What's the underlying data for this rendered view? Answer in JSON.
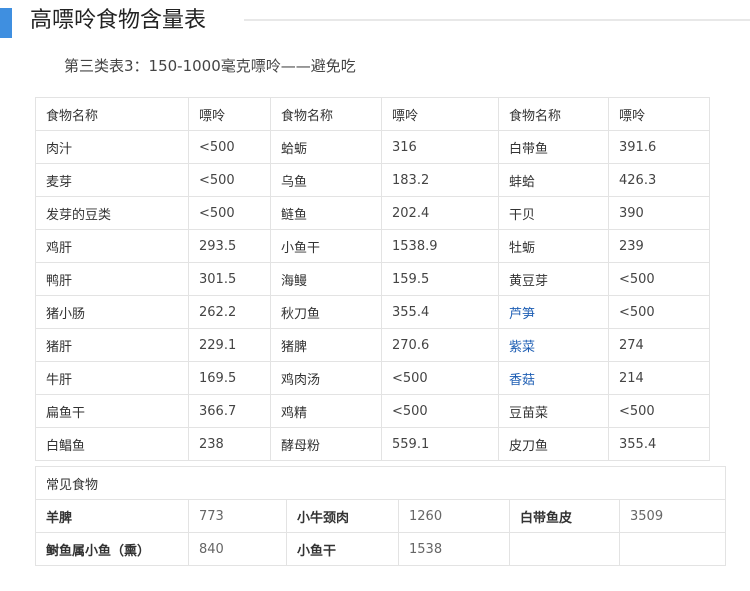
{
  "page_title": "高嘌呤食物含量表",
  "subtitle": "第三类表3：150-1000毫克嘌呤——避免吃",
  "accent_color": "#3f8fe0",
  "link_color": "#1f5fb4",
  "table": {
    "headers": [
      "食物名称",
      "嘌呤",
      "食物名称",
      "嘌呤",
      "食物名称",
      "嘌呤"
    ],
    "rows": [
      [
        "肉汁",
        "<500",
        "蛤蛎",
        "316",
        "白带鱼",
        "391.6"
      ],
      [
        "麦芽",
        "<500",
        "乌鱼",
        "183.2",
        "蚌蛤",
        "426.3"
      ],
      [
        "发芽的豆类",
        "<500",
        "鲢鱼",
        "202.4",
        "干贝",
        "390"
      ],
      [
        "鸡肝",
        "293.5",
        "小鱼干",
        "1538.9",
        "牡蛎",
        "239"
      ],
      [
        "鸭肝",
        "301.5",
        "海鳗",
        "159.5",
        "黄豆芽",
        "<500"
      ],
      [
        "猪小肠",
        "262.2",
        "秋刀鱼",
        "355.4",
        "芦笋",
        "<500"
      ],
      [
        "猪肝",
        "229.1",
        "猪脾",
        "270.6",
        "紫菜",
        "274"
      ],
      [
        "牛肝",
        "169.5",
        "鸡肉汤",
        "<500",
        "香菇",
        "214"
      ],
      [
        "扁鱼干",
        "366.7",
        "鸡精",
        "<500",
        "豆苗菜",
        "<500"
      ],
      [
        "白鲳鱼",
        "238",
        "酵母粉",
        "559.1",
        "皮刀鱼",
        "355.4"
      ]
    ]
  },
  "common_foods": {
    "caption": "常见食物",
    "rows": [
      [
        "羊脾",
        "773",
        "小牛颈肉",
        "1260",
        "白带鱼皮",
        "3509"
      ],
      [
        "鲥鱼属小鱼（熏）",
        "840",
        "小鱼干",
        "1538",
        "",
        ""
      ]
    ]
  }
}
